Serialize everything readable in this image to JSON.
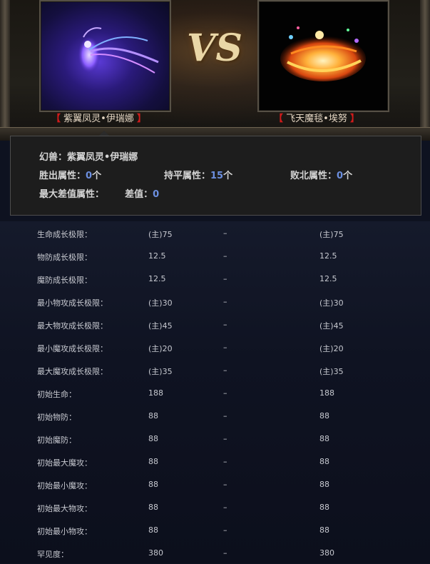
{
  "compare": {
    "left_name": "紫翼凤灵•伊瑞娜",
    "right_name": "飞天魔毯•埃努",
    "bracket_open": "【",
    "bracket_close": "】",
    "vs_label": "VS"
  },
  "summary": {
    "pet_label": "幻兽：紫翼凤灵•伊瑞娜",
    "win_label": "胜出属性：",
    "win_value": "0",
    "draw_label": "持平属性：",
    "draw_value": "15",
    "lose_label": "败北属性：",
    "lose_value": "0",
    "unit": "个",
    "max_diff_label": "最大差值属性：",
    "diff_label": "差值：",
    "diff_value": "0"
  },
  "stats": [
    {
      "label": "生命成长极限：",
      "left": "(主)75",
      "dash": "–",
      "right": "(主)75"
    },
    {
      "label": "物防成长极限：",
      "left": "12.5",
      "dash": "–",
      "right": "12.5"
    },
    {
      "label": "魔防成长极限：",
      "left": "12.5",
      "dash": "–",
      "right": "12.5"
    },
    {
      "label": "最小物攻成长极限：",
      "left": "(主)30",
      "dash": "–",
      "right": "(主)30"
    },
    {
      "label": "最大物攻成长极限：",
      "left": "(主)45",
      "dash": "–",
      "right": "(主)45"
    },
    {
      "label": "最小魔攻成长极限：",
      "left": "(主)20",
      "dash": "–",
      "right": "(主)20"
    },
    {
      "label": "最大魔攻成长极限：",
      "left": "(主)35",
      "dash": "–",
      "right": "(主)35"
    },
    {
      "label": "初始生命：",
      "left": "188",
      "dash": "–",
      "right": "188"
    },
    {
      "label": "初始物防：",
      "left": "88",
      "dash": "–",
      "right": "88"
    },
    {
      "label": "初始魔防：",
      "left": "88",
      "dash": "–",
      "right": "88"
    },
    {
      "label": "初始最大魔攻：",
      "left": "88",
      "dash": "–",
      "right": "88"
    },
    {
      "label": "初始最小魔攻：",
      "left": "88",
      "dash": "–",
      "right": "88"
    },
    {
      "label": "初始最大物攻：",
      "left": "88",
      "dash": "–",
      "right": "88"
    },
    {
      "label": "初始最小物攻：",
      "left": "88",
      "dash": "–",
      "right": "88"
    },
    {
      "label": "罕见度：",
      "left": "380",
      "dash": "–",
      "right": "380"
    }
  ],
  "colors": {
    "highlight_number": "#6c8fe0",
    "bracket_red": "#d11b1b",
    "vs_gold": "#e9d6a6"
  }
}
